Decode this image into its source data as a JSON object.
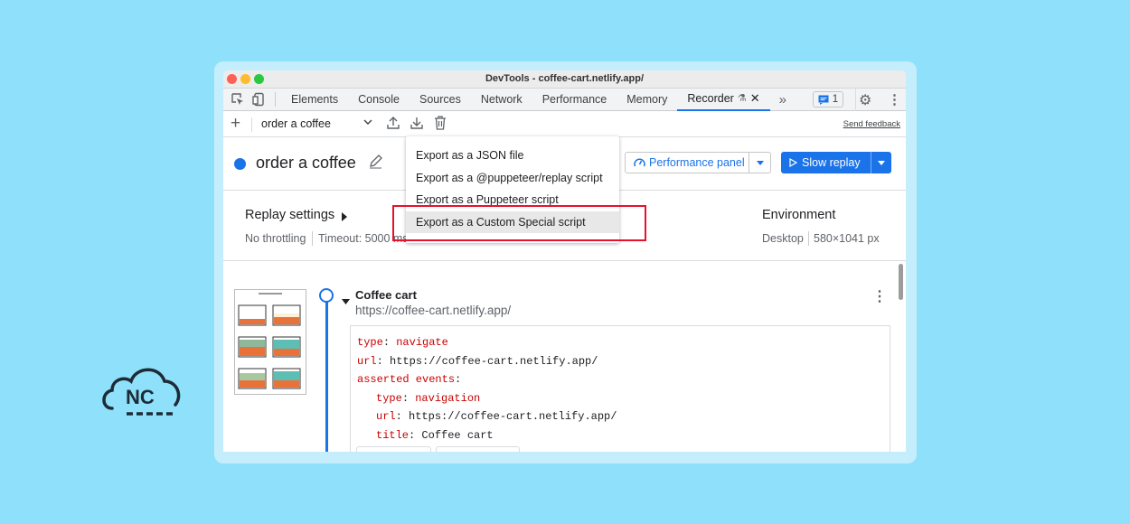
{
  "window": {
    "title": "DevTools - coffee-cart.netlify.app/"
  },
  "tabs": [
    {
      "label": "Elements"
    },
    {
      "label": "Console"
    },
    {
      "label": "Sources"
    },
    {
      "label": "Network"
    },
    {
      "label": "Performance"
    },
    {
      "label": "Memory"
    },
    {
      "label": "Recorder"
    }
  ],
  "issues_count": "1",
  "toolbar": {
    "recording_name": "order a coffee",
    "send_feedback": "Send feedback"
  },
  "header": {
    "title": "order a coffee",
    "performance_panel": "Performance panel",
    "slow_replay": "Slow replay"
  },
  "export_menu": {
    "items": [
      "Export as a JSON file",
      "Export as a @puppeteer/replay script",
      "Export as a Puppeteer script",
      "Export as a Custom Special script"
    ]
  },
  "replay_settings": {
    "title": "Replay settings",
    "throttling": "No throttling",
    "timeout": "Timeout: 5000 ms"
  },
  "environment": {
    "title": "Environment",
    "device": "Desktop",
    "size": "580×1041 px"
  },
  "step": {
    "title": "Coffee cart",
    "url": "https://coffee-cart.netlify.app/",
    "code": {
      "type_key": "type",
      "type_val": "navigate",
      "url_key": "url",
      "url_val": "https://coffee-cart.netlify.app/",
      "events_key": "asserted events",
      "ev_type_key": "type",
      "ev_type_val": "navigation",
      "ev_url_key": "url",
      "ev_url_val": "https://coffee-cart.netlify.app/",
      "ev_title_key": "title",
      "ev_title_val": "Coffee cart"
    }
  },
  "logo": {
    "text": "NC"
  },
  "colors": {
    "accent": "#1a73e8",
    "highlight": "#e8112d",
    "background": "#8fe0fa"
  }
}
